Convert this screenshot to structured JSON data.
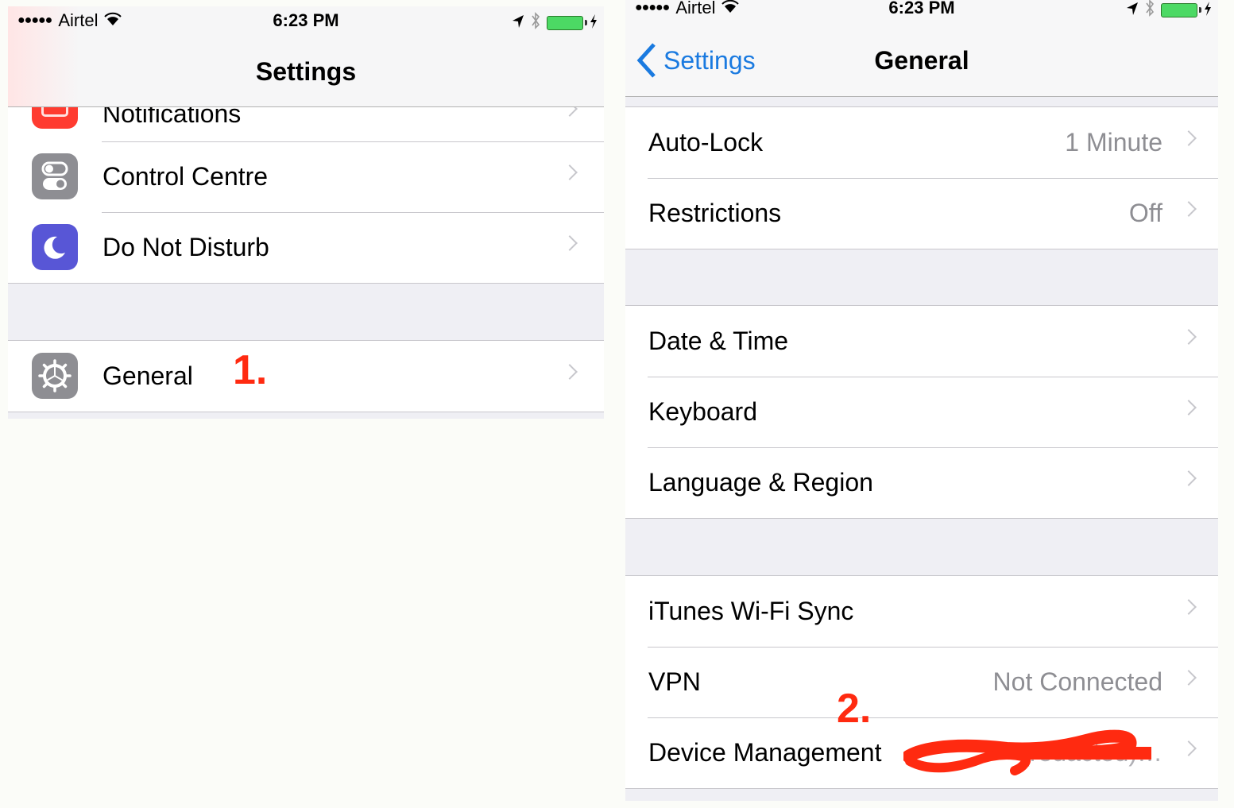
{
  "left_screen": {
    "status_bar": {
      "carrier": "Airtel",
      "signal_dots": "●●●●●",
      "time": "6:23 PM"
    },
    "nav_title": "Settings",
    "partial_item": {
      "label": "Notifications",
      "icon": "notifications-icon",
      "icon_color": "#ff3b30"
    },
    "group1": [
      {
        "label": "Control Centre",
        "icon": "control-centre-icon",
        "icon_color": "#8e8e93"
      },
      {
        "label": "Do Not Disturb",
        "icon": "moon-icon",
        "icon_color": "#5856d6"
      }
    ],
    "group2": [
      {
        "label": "General",
        "icon": "gear-icon",
        "icon_color": "#8e8e93"
      }
    ],
    "annotation": "1."
  },
  "right_screen": {
    "status_bar": {
      "carrier": "Airtel",
      "signal_dots": "●●●●●",
      "time": "6:23 PM"
    },
    "back_label": "Settings",
    "nav_title": "General",
    "group1": [
      {
        "label": "Auto-Lock",
        "value": "1 Minute"
      },
      {
        "label": "Restrictions",
        "value": "Off"
      }
    ],
    "group2": [
      {
        "label": "Date & Time",
        "value": ""
      },
      {
        "label": "Keyboard",
        "value": ""
      },
      {
        "label": "Language & Region",
        "value": ""
      }
    ],
    "group3": [
      {
        "label": "iTunes Wi-Fi Sync",
        "value": ""
      },
      {
        "label": "VPN",
        "value": "Not Connected"
      },
      {
        "label": "Device Management",
        "value": "(redacted)…"
      }
    ],
    "annotation": "2."
  },
  "colors": {
    "accent": "#1a7ae0",
    "annotation": "#ff2a10",
    "battery": "#4cd964"
  }
}
